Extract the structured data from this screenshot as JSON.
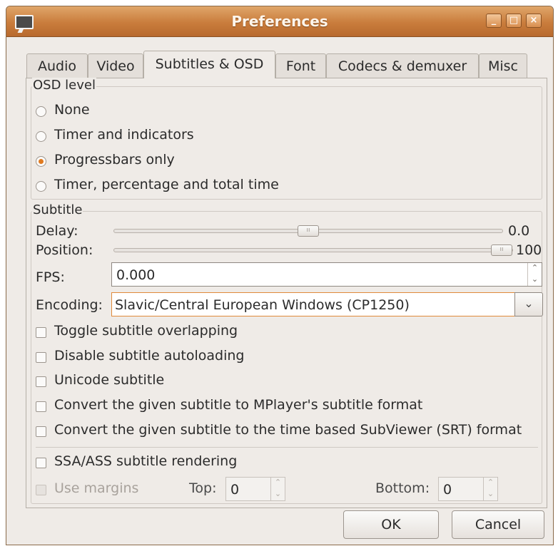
{
  "window": {
    "title": "Preferences",
    "controls": {
      "minimize": "_",
      "maximize": "□",
      "close": "×"
    }
  },
  "tabs": [
    "Audio",
    "Video",
    "Subtitles & OSD",
    "Font",
    "Codecs & demuxer",
    "Misc"
  ],
  "active_tab": "Subtitles & OSD",
  "osd": {
    "legend": "OSD level",
    "options": [
      "None",
      "Timer and indicators",
      "Progressbars only",
      "Timer, percentage and total time"
    ],
    "selected": "Progressbars only"
  },
  "subtitle": {
    "legend": "Subtitle",
    "delay_label": "Delay:",
    "delay_value": "0.0",
    "delay_fraction": 0.5,
    "position_label": "Position:",
    "position_value": "100",
    "position_fraction": 1.0,
    "fps_label": "FPS:",
    "fps_value": "0.000",
    "encoding_label": "Encoding:",
    "encoding_value": "Slavic/Central European Windows (CP1250)",
    "checkboxes": [
      "Toggle subtitle overlapping",
      "Disable subtitle autoloading",
      "Unicode subtitle",
      "Convert the given subtitle to MPlayer's subtitle format",
      "Convert the given subtitle to the time based SubViewer (SRT) format"
    ],
    "ssa_label": "SSA/ASS subtitle rendering",
    "use_margins_label": "Use margins",
    "top_label": "Top:",
    "top_value": "0",
    "bottom_label": "Bottom:",
    "bottom_value": "0"
  },
  "buttons": {
    "ok": "OK",
    "cancel": "Cancel"
  }
}
